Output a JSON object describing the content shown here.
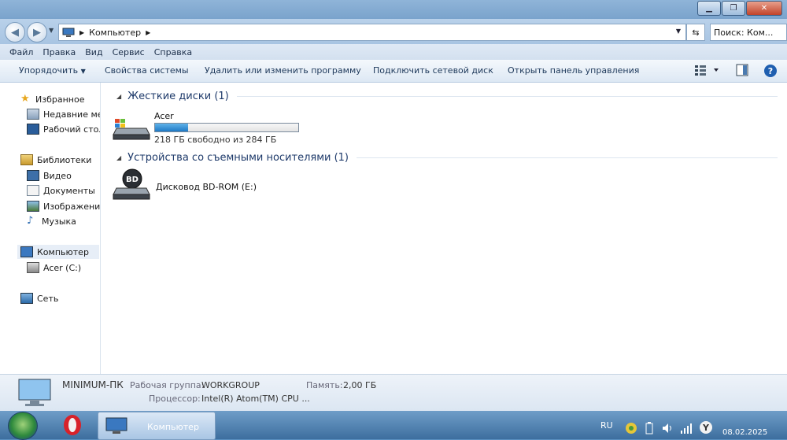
{
  "window": {
    "minimize": "▁",
    "maximize": "❐",
    "close": "✕"
  },
  "address": {
    "crumb": "Компьютер",
    "search_placeholder": "Поиск: Ком..."
  },
  "menu": [
    "Файл",
    "Правка",
    "Вид",
    "Сервис",
    "Справка"
  ],
  "toolbar": {
    "organize": "Упорядочить",
    "system_properties": "Свойства системы",
    "uninstall": "Удалить или изменить программу",
    "map_drive": "Подключить сетевой диск",
    "control_panel": "Открыть панель управления"
  },
  "sidebar": {
    "favorites": "Избранное",
    "recent": "Недавние места",
    "desktop": "Рабочий стол",
    "libraries": "Библиотеки",
    "video": "Видео",
    "documents": "Документы",
    "pictures": "Изображения",
    "music": "Музыка",
    "computer": "Компьютер",
    "drive_c": "Acer (C:)",
    "network": "Сеть"
  },
  "content": {
    "hard_disks_header": "Жесткие диски (1)",
    "removable_header": "Устройства со съемными носителями (1)",
    "drive_c": {
      "name": "Acer (C:)",
      "free_text": "218 ГБ свободно из 284 ГБ",
      "used_fraction": 0.23
    },
    "bd_drive": {
      "name": "Дисковод BD-ROM (E:)",
      "icon_text": "BD"
    }
  },
  "details": {
    "computer_name": "MINIMUM-ПК",
    "workgroup_label": "Рабочая группа:",
    "workgroup_value": "WORKGROUP",
    "memory_label": "Память:",
    "memory_value": "2,00 ГБ",
    "cpu_label": "Процессор:",
    "cpu_value": "Intel(R) Atom(TM) CPU ..."
  },
  "taskbar": {
    "task_label": "Компьютер",
    "language": "RU",
    "date": "08.02.2025"
  }
}
